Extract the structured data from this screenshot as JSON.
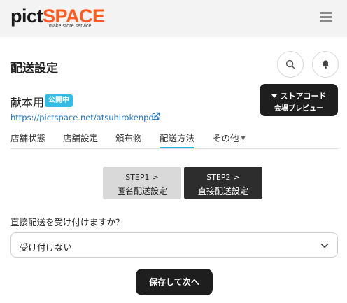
{
  "header": {
    "logo_pict": "pict",
    "logo_space": "SPACE",
    "logo_tagline": "make store service",
    "menu_icon": "hamburger-menu-icon"
  },
  "page": {
    "title": "配送設定",
    "search_icon": "search-icon",
    "bell_icon": "bell-icon"
  },
  "store": {
    "name": "献本用",
    "status_badge": "公開中",
    "url": "https://pictspace.net/atsuhirokenpon",
    "external_link_icon": "external-link-icon"
  },
  "preview_button": {
    "line1": "ストアコード",
    "line2": "会場プレビュー"
  },
  "tabs": [
    {
      "label": "店舗状態",
      "active": false
    },
    {
      "label": "店舗設定",
      "active": false
    },
    {
      "label": "頒布物",
      "active": false
    },
    {
      "label": "配送方法",
      "active": true
    },
    {
      "label": "その他",
      "active": false,
      "has_dropdown": true
    }
  ],
  "steps": [
    {
      "step": "STEP1",
      "label": "匿名配送設定",
      "active": false
    },
    {
      "step": "STEP2",
      "label": "直接配送設定",
      "active": true
    }
  ],
  "form": {
    "question": "直接配送を受け付けますか？",
    "selected_value": "受け付けない"
  },
  "save_button": "保存して次へ",
  "colors": {
    "accent": "#33bde6",
    "logo_space": "#ff5a1f",
    "dark_button": "#1e1e1e",
    "highlight": "#ffef14",
    "link": "#1a73c9"
  }
}
